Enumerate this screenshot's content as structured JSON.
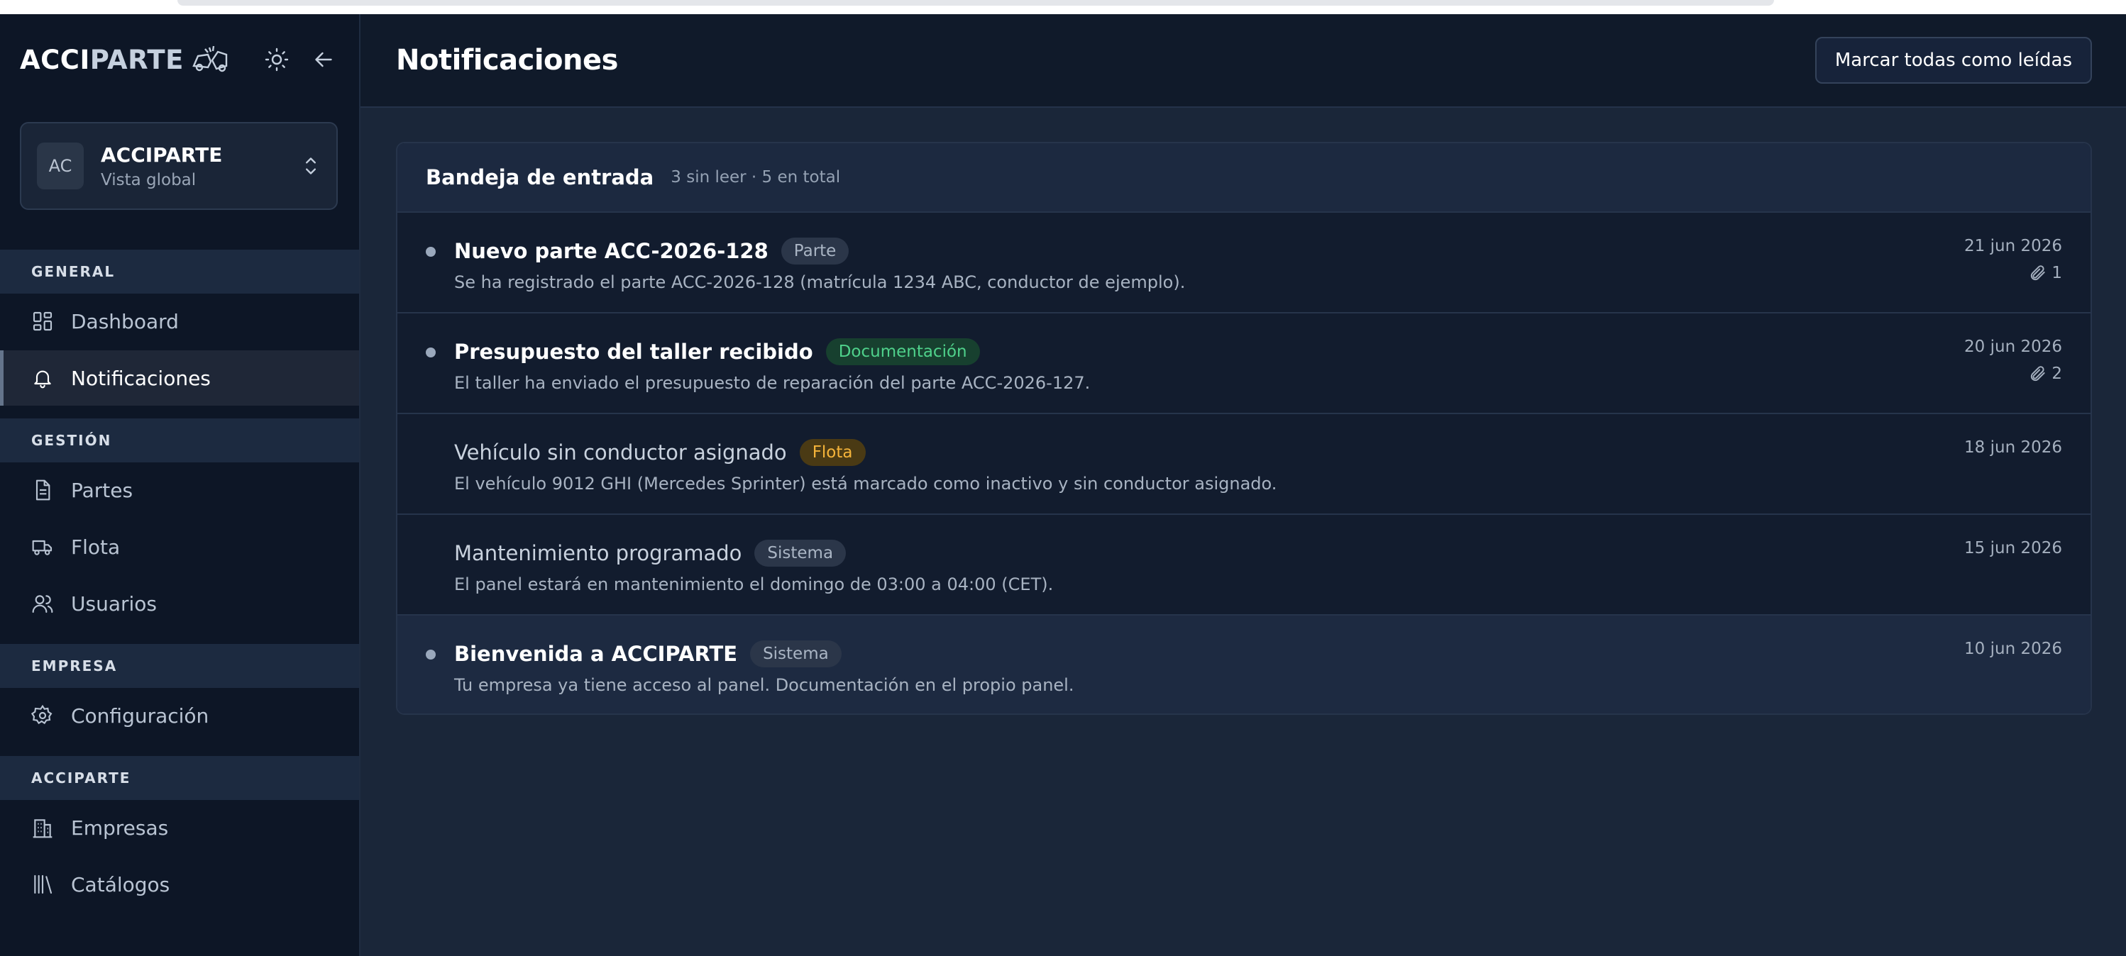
{
  "brand": {
    "logo_part1": "ACCI",
    "logo_part2": "PARTE"
  },
  "org": {
    "initials": "AC",
    "name": "ACCIPARTE",
    "subtitle": "Vista global"
  },
  "sidebar": {
    "sections": [
      {
        "label": "GENERAL",
        "items": [
          {
            "label": "Dashboard"
          },
          {
            "label": "Notificaciones"
          }
        ]
      },
      {
        "label": "GESTIÓN",
        "items": [
          {
            "label": "Partes"
          },
          {
            "label": "Flota"
          },
          {
            "label": "Usuarios"
          }
        ]
      },
      {
        "label": "EMPRESA",
        "items": [
          {
            "label": "Configuración"
          }
        ]
      },
      {
        "label": "ACCIPARTE",
        "items": [
          {
            "label": "Empresas"
          },
          {
            "label": "Catálogos"
          }
        ]
      }
    ]
  },
  "header": {
    "title": "Notificaciones",
    "mark_all_label": "Marcar todas como leídas"
  },
  "inbox": {
    "title": "Bandeja de entrada",
    "meta": "3 sin leer · 5 en total",
    "items": [
      {
        "title": "Nuevo parte ACC-2026-128",
        "badge": "Parte",
        "desc": "Se ha registrado el parte ACC-2026-128 (matrícula 1234 ABC, conductor de ejemplo).",
        "date": "21 jun 2026",
        "attachments": "1"
      },
      {
        "title": "Presupuesto del taller recibido",
        "badge": "Documentación",
        "desc": "El taller ha enviado el presupuesto de reparación del parte ACC-2026-127.",
        "date": "20 jun 2026",
        "attachments": "2"
      },
      {
        "title": "Vehículo sin conductor asignado",
        "badge": "Flota",
        "desc": "El vehículo 9012 GHI (Mercedes Sprinter) está marcado como inactivo y sin conductor asignado.",
        "date": "18 jun 2026"
      },
      {
        "title": "Mantenimiento programado",
        "badge": "Sistema",
        "desc": "El panel estará en mantenimiento el domingo de 03:00 a 04:00 (CET).",
        "date": "15 jun 2026"
      },
      {
        "title": "Bienvenida a ACCIPARTE",
        "badge": "Sistema",
        "desc": "Tu empresa ya tiene acceso al panel. Documentación en el propio panel.",
        "date": "10 jun 2026"
      }
    ]
  },
  "colors": {
    "accent_green": "#4fd18b",
    "accent_amber": "#f5b43a",
    "background": "#1a2639",
    "sidebar": "#0d1626"
  }
}
